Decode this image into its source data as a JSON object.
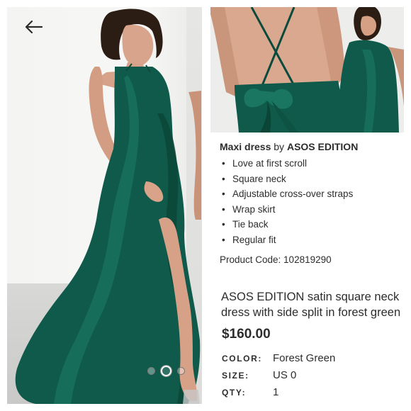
{
  "colors": {
    "dress_green": "#0f5a4a",
    "text": "#2d2d2d",
    "background": "#ffffff"
  },
  "navigation": {
    "back_icon": "arrow-left-icon"
  },
  "gallery": {
    "total_images": 3,
    "active_index": 1
  },
  "description": {
    "type_label": "Maxi dress",
    "by_label": "by",
    "brand": "ASOS EDITION",
    "features": [
      "Love at first scroll",
      "Square neck",
      "Adjustable cross-over straps",
      "Wrap skirt",
      "Tie back",
      "Regular fit"
    ],
    "product_code": "Product Code: 102819290"
  },
  "product": {
    "name_line1": "ASOS EDITION satin square neck",
    "name_line2": "dress with side split in forest green",
    "price": "$160.00"
  },
  "attributes": {
    "color_label": "COLOR:",
    "color_value": "Forest Green",
    "size_label": "SIZE:",
    "size_value": "US 0",
    "qty_label": "QTY:",
    "qty_value": "1"
  }
}
